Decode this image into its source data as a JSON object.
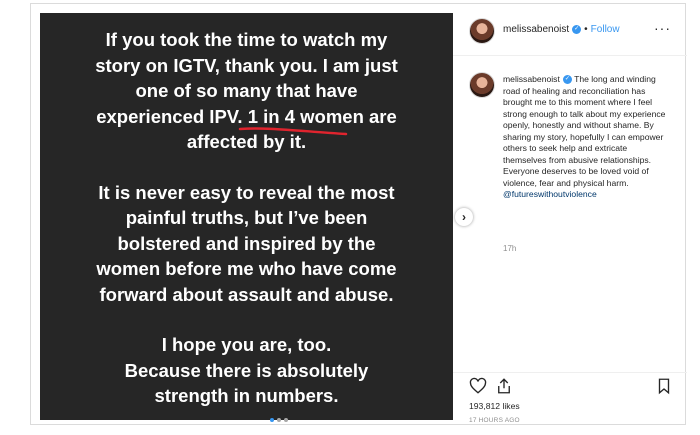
{
  "post": {
    "image_text": {
      "paragraph1": [
        "If you took the time to watch my",
        "story on IGTV, thank you. I am just",
        "one of so many that have",
        "experienced IPV. 1 in 4 women are",
        "affected by it."
      ],
      "paragraph2": [
        "It is never easy to reveal the most",
        "painful truths, but I’ve been",
        "bolstered and inspired by the",
        "women before me who have come",
        "forward about assault and abuse."
      ],
      "paragraph3": [
        "I hope you are, too.",
        "Because there is absolutely",
        "strength in numbers."
      ]
    },
    "next_arrow": "›"
  },
  "header": {
    "username": "melissabenoist",
    "separator": "•",
    "follow_label": "Follow",
    "more_label": "···"
  },
  "caption": {
    "username": "melissabenoist",
    "text": "The long and winding road of healing and reconciliation has brought me to this moment where I feel strong enough to talk about my experience openly, honestly and without shame. By sharing my story, hopefully I can empower others to seek help and extricate themselves from abusive relationships. Everyone deserves to be loved void of violence, fear and physical harm.",
    "mention": "@futureswithoutviolence",
    "time": "17h"
  },
  "footer": {
    "likes": "193,812 likes",
    "posted_ago": "17 HOURS AGO"
  },
  "colors": {
    "accent": "#3897f0",
    "underline": "#e0242e",
    "media_bg": "#262626"
  }
}
